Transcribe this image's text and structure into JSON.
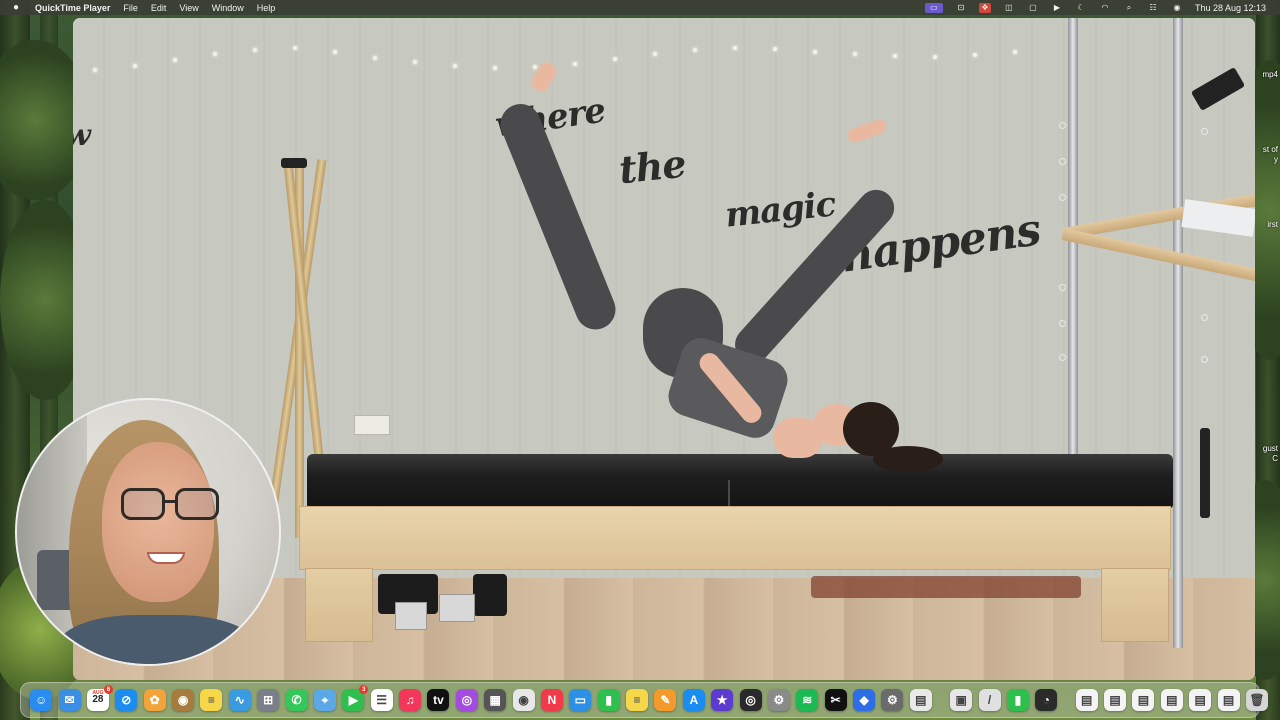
{
  "menubar": {
    "app_name": "QuickTime Player",
    "menus": [
      "File",
      "Edit",
      "View",
      "Window",
      "Help"
    ],
    "clock": "Thu 28 Aug  12:13"
  },
  "wall_text": {
    "word1": "where",
    "word2": "the",
    "word3": "magic",
    "word4": "happens",
    "word_left": "w"
  },
  "desktop_edge_labels": [
    "mp4",
    "st of",
    "y",
    "irst",
    "gust",
    "C"
  ],
  "dock": {
    "calendar_day": "28",
    "calendar_month": "AUG",
    "mail_badge": "",
    "facetime_badge": "3",
    "calendar_badge": "6",
    "apps": [
      {
        "name": "finder",
        "color": "#2b8cf0",
        "glyph": "☺"
      },
      {
        "name": "mail",
        "color": "#3a8ee6",
        "glyph": "✉"
      },
      {
        "name": "calendar",
        "color": "#ffffff",
        "glyph": ""
      },
      {
        "name": "safari",
        "color": "#1d8cf0",
        "glyph": "⊘"
      },
      {
        "name": "photos",
        "color": "#f2a33a",
        "glyph": "✿"
      },
      {
        "name": "notes-brown",
        "color": "#a57c3d",
        "glyph": "◉"
      },
      {
        "name": "notes",
        "color": "#f7d74a",
        "glyph": "≡"
      },
      {
        "name": "freeform",
        "color": "#3a9be0",
        "glyph": "∿"
      },
      {
        "name": "launchpad",
        "color": "#7a7f8a",
        "glyph": "⊞"
      },
      {
        "name": "messages",
        "color": "#34c759",
        "glyph": "✆"
      },
      {
        "name": "maps",
        "color": "#5aa9e6",
        "glyph": "⌖"
      },
      {
        "name": "facetime",
        "color": "#2fbf4f",
        "glyph": "▶"
      },
      {
        "name": "reminders",
        "color": "#ffffff",
        "glyph": "☰"
      },
      {
        "name": "music",
        "color": "#f2375a",
        "glyph": "♫"
      },
      {
        "name": "apple-tv",
        "color": "#111111",
        "glyph": "tv"
      },
      {
        "name": "podcasts",
        "color": "#a24ce0",
        "glyph": "◎"
      },
      {
        "name": "calculator",
        "color": "#555555",
        "glyph": "▦"
      },
      {
        "name": "chrome",
        "color": "#e8e8e8",
        "glyph": "◉"
      },
      {
        "name": "news",
        "color": "#f23a4a",
        "glyph": "N"
      },
      {
        "name": "keynote",
        "color": "#2c90e6",
        "glyph": "▭"
      },
      {
        "name": "numbers",
        "color": "#2fbf4f",
        "glyph": "▮"
      },
      {
        "name": "stickies",
        "color": "#f7d74a",
        "glyph": "≡"
      },
      {
        "name": "pages",
        "color": "#f39a2b",
        "glyph": "✎"
      },
      {
        "name": "app-store",
        "color": "#1b8cf0",
        "glyph": "A"
      },
      {
        "name": "imovie",
        "color": "#5b3bd0",
        "glyph": "★"
      },
      {
        "name": "screenshot",
        "color": "#2a2a2a",
        "glyph": "◎"
      },
      {
        "name": "system-settings",
        "color": "#8a8a8a",
        "glyph": "⚙"
      },
      {
        "name": "spotify",
        "color": "#1db954",
        "glyph": "≋"
      },
      {
        "name": "capcut",
        "color": "#111111",
        "glyph": "✂"
      },
      {
        "name": "dropbox",
        "color": "#2d6de6",
        "glyph": "◆"
      },
      {
        "name": "automator",
        "color": "#6b6b6b",
        "glyph": "⚙"
      },
      {
        "name": "preview",
        "color": "#e9e9e9",
        "glyph": "▤"
      }
    ],
    "recent_apps": [
      {
        "name": "quicktime",
        "color": "#e6e6e6",
        "glyph": "▣"
      },
      {
        "name": "script-editor",
        "color": "#e0e0e0",
        "glyph": "/"
      },
      {
        "name": "numbers-green",
        "color": "#2fbf4f",
        "glyph": "▮"
      },
      {
        "name": "screen-time",
        "color": "#2b2b2b",
        "glyph": "◔"
      }
    ],
    "documents": [
      {
        "name": "document-1",
        "color": "#f4f4f4",
        "glyph": "▤"
      },
      {
        "name": "document-2",
        "color": "#f4f4f4",
        "glyph": "▤"
      },
      {
        "name": "document-3",
        "color": "#f4f4f4",
        "glyph": "▤"
      },
      {
        "name": "document-4",
        "color": "#f4f4f4",
        "glyph": "▤"
      },
      {
        "name": "document-5",
        "color": "#f4f4f4",
        "glyph": "▤"
      },
      {
        "name": "document-6",
        "color": "#f4f4f4",
        "glyph": "▤"
      },
      {
        "name": "trash",
        "color": "#d6d6d6",
        "glyph": "🗑"
      }
    ]
  }
}
